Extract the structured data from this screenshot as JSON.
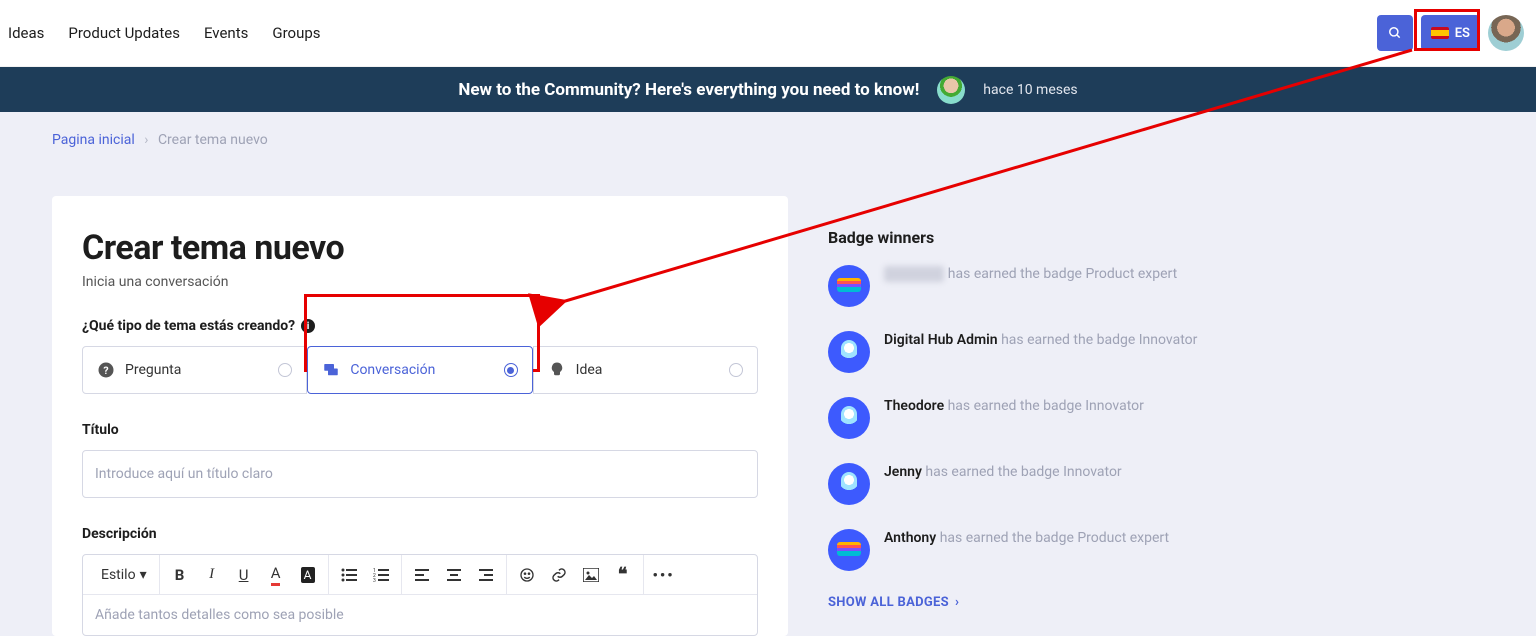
{
  "nav": {
    "items": [
      "Ideas",
      "Product Updates",
      "Events",
      "Groups"
    ]
  },
  "lang": {
    "code": "ES"
  },
  "banner": {
    "title": "New to the Community? Here's everything you need to know!",
    "time": "hace 10 meses"
  },
  "crumbs": {
    "home": "Pagina inicial",
    "current": "Crear tema nuevo"
  },
  "form": {
    "heading": "Crear tema nuevo",
    "subtitle": "Inicia una conversación",
    "type_label": "¿Qué tipo de tema estás creando?",
    "types": {
      "question": "Pregunta",
      "conversation": "Conversación",
      "idea": "Idea"
    },
    "title_label": "Título",
    "title_placeholder": "Introduce aquí un título claro",
    "desc_label": "Descripción",
    "desc_placeholder": "Añade tantos detalles como sea posible",
    "style_label": "Estilo"
  },
  "sidebar": {
    "heading": "Badge winners",
    "suffix_earned": " has earned the badge ",
    "badges": {
      "expert": "Product expert",
      "innovator": "Innovator"
    },
    "winners": [
      {
        "name": "",
        "hidden": true,
        "badge": "expert"
      },
      {
        "name": "Digital Hub Admin",
        "badge": "innovator"
      },
      {
        "name": "Theodore",
        "badge": "innovator"
      },
      {
        "name": "Jenny",
        "badge": "innovator"
      },
      {
        "name": "Anthony",
        "badge": "expert"
      }
    ],
    "show_all": "SHOW ALL BADGES"
  }
}
